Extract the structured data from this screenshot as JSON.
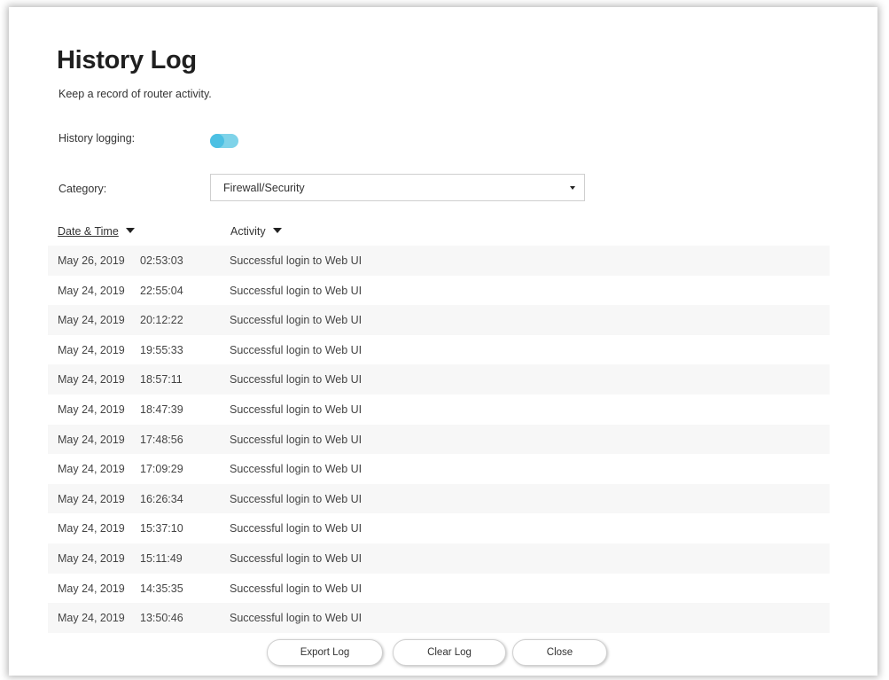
{
  "dialog": {
    "title": "History Log",
    "subtitle": "Keep a record of router activity."
  },
  "logging": {
    "label": "History logging:",
    "enabled": true,
    "toggle_color": "#4cc0e3"
  },
  "category": {
    "label": "Category:",
    "selected": "Firewall/Security"
  },
  "table": {
    "columns": [
      "Date & Time",
      "Activity"
    ],
    "rows": [
      {
        "date": "May 26, 2019",
        "time": "02:53:03",
        "activity": "Successful login to Web UI"
      },
      {
        "date": "May 24, 2019",
        "time": "22:55:04",
        "activity": "Successful login to Web UI"
      },
      {
        "date": "May 24, 2019",
        "time": "20:12:22",
        "activity": "Successful login to Web UI"
      },
      {
        "date": "May 24, 2019",
        "time": "19:55:33",
        "activity": "Successful login to Web UI"
      },
      {
        "date": "May 24, 2019",
        "time": "18:57:11",
        "activity": "Successful login to Web UI"
      },
      {
        "date": "May 24, 2019",
        "time": "18:47:39",
        "activity": "Successful login to Web UI"
      },
      {
        "date": "May 24, 2019",
        "time": "17:48:56",
        "activity": "Successful login to Web UI"
      },
      {
        "date": "May 24, 2019",
        "time": "17:09:29",
        "activity": "Successful login to Web UI"
      },
      {
        "date": "May 24, 2019",
        "time": "16:26:34",
        "activity": "Successful login to Web UI"
      },
      {
        "date": "May 24, 2019",
        "time": "15:37:10",
        "activity": "Successful login to Web UI"
      },
      {
        "date": "May 24, 2019",
        "time": "15:11:49",
        "activity": "Successful login to Web UI"
      },
      {
        "date": "May 24, 2019",
        "time": "14:35:35",
        "activity": "Successful login to Web UI"
      },
      {
        "date": "May 24, 2019",
        "time": "13:50:46",
        "activity": "Successful login to Web UI"
      }
    ]
  },
  "buttons": {
    "export": "Export Log",
    "clear": "Clear Log",
    "close": "Close"
  },
  "icons": {
    "dropdown": "caret-down-icon",
    "sort": "sort-caret-down-icon"
  }
}
